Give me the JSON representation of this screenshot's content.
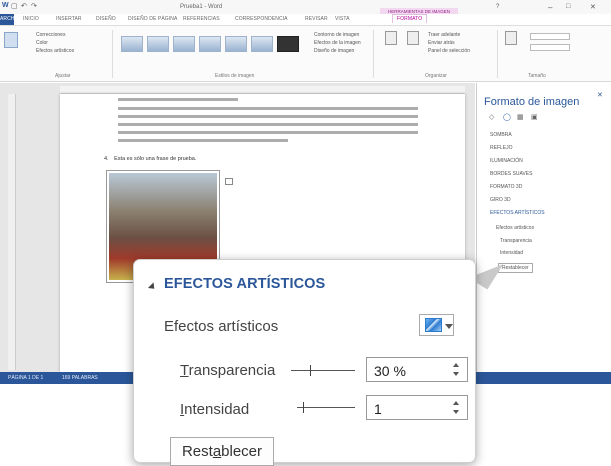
{
  "app": {
    "title_partial": "Prueba1 - Word",
    "tool_context": "HERRAMIENTAS DE IMAGEN"
  },
  "tabs": [
    "ARCHIVO",
    "INICIO",
    "INSERTAR",
    "DISEÑO",
    "DISEÑO DE PÁGINA",
    "REFERENCIAS",
    "CORRESPONDENCIA",
    "REVISAR",
    "VISTA",
    "FORMATO"
  ],
  "ribbon": {
    "groups": [
      "Ajustar",
      "Estilos de imagen",
      "Organizar",
      "Tamaño"
    ],
    "adjust_items": [
      "Correcciones",
      "Color",
      "Efectos artísticos"
    ],
    "style_items": [
      "Contorno de imagen",
      "Efectos de la imagen",
      "Diseño de imagen"
    ],
    "arrange_items": [
      "Posición",
      "Ajustar texto",
      "Traer adelante",
      "Enviar atrás",
      "Panel de selección"
    ],
    "size_items": [
      "Recortar",
      "Alto",
      "Ancho"
    ]
  },
  "document": {
    "list_items": [
      "Su mujer, María Rosa, de enormes ojos..."
    ],
    "line4_label": "4.",
    "line4_text": "Esta es sólo una frase de prueba."
  },
  "status_bar": {
    "page": "PÁGINA 1 DE 1",
    "words": "169 PALABRAS"
  },
  "pane": {
    "title": "Formato de imagen",
    "items": [
      "SOMBRA",
      "REFLEJO",
      "ILUMINACIÓN",
      "BORDES SUAVES",
      "FORMATO 3D",
      "GIRO 3D",
      "EFECTOS ARTÍSTICOS"
    ],
    "sub_items": [
      "Efectos artísticos",
      "Transparencia",
      "Intensidad",
      "Restablecer"
    ]
  },
  "zoom": {
    "heading": "EFECTOS ARTÍSTICOS",
    "artistic_effects_label": "Efectos artísticos",
    "transparency_label_first": "T",
    "transparency_label_rest": "ransparencia",
    "transparency_value": "30 %",
    "intensity_label_first": "I",
    "intensity_label_rest": "ntensidad",
    "intensity_value": "1",
    "reset_label_pre": "Rest",
    "reset_label_u": "a",
    "reset_label_post": "blecer"
  }
}
